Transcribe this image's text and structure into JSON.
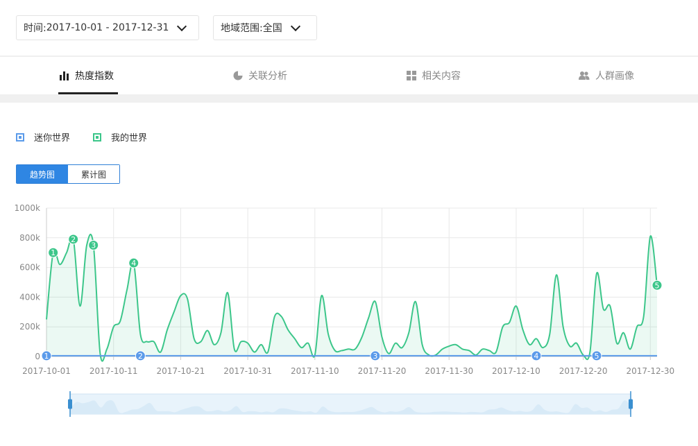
{
  "filters": {
    "time_label": "时间:",
    "time_value": "2017-10-01 - 2017-12-31",
    "region_label": "地域范围:",
    "region_value": "全国"
  },
  "tabs": [
    {
      "label": "热度指数",
      "icon": "bar-chart-icon",
      "active": true
    },
    {
      "label": "关联分析",
      "icon": "pie-chart-icon",
      "active": false
    },
    {
      "label": "相关内容",
      "icon": "grid-icon",
      "active": false
    },
    {
      "label": "人群画像",
      "icon": "users-icon",
      "active": false
    }
  ],
  "view_toggle": {
    "trend": "趋势图",
    "cumulative": "累计图",
    "selected": "趋势图"
  },
  "colors": {
    "accent": "#2f86e3",
    "series_blue": "#5b9bea",
    "series_green": "#3cc68a"
  },
  "chart_data": {
    "type": "area",
    "x_start": "2017-10-01",
    "x_ticks": [
      "2017-10-01",
      "2017-10-11",
      "2017-10-21",
      "2017-10-31",
      "2017-11-10",
      "2017-11-20",
      "2017-11-30",
      "2017-12-10",
      "2017-12-20",
      "2017-12-30"
    ],
    "y_ticks": [
      "0",
      "200k",
      "400k",
      "600k",
      "800k",
      "1000k"
    ],
    "ylim": [
      0,
      1000000
    ],
    "grid": true,
    "legend_position": "top-left",
    "series": [
      {
        "name": "迷你世界",
        "color": "#5b9bea",
        "values": [
          5000,
          5000,
          5000,
          5000,
          5000,
          5000,
          5000,
          5000,
          5000,
          5000,
          5000,
          5000,
          5000,
          5000,
          5000,
          5000,
          5000,
          5000,
          5000,
          5000,
          5000,
          5000,
          5000,
          5000,
          5000,
          5000,
          5000,
          5000,
          5000,
          5000,
          5000,
          5000,
          5000,
          5000,
          5000,
          5000,
          5000,
          5000,
          5000,
          5000,
          5000,
          5000,
          5000,
          5000,
          5000,
          5000,
          5000,
          5000,
          5000,
          5000,
          5000,
          5000,
          5000,
          5000,
          5000,
          5000,
          5000,
          5000,
          5000,
          5000,
          5000,
          5000,
          5000,
          5000,
          5000,
          5000,
          5000,
          5000,
          5000,
          5000,
          5000,
          5000,
          5000,
          5000,
          5000,
          5000,
          5000,
          5000,
          5000,
          5000,
          5000,
          5000,
          5000,
          5000,
          5000,
          5000,
          5000,
          5000,
          5000,
          5000,
          5000,
          5000
        ],
        "markers": [
          {
            "label": "1",
            "date": "2017-10-01"
          },
          {
            "label": "2",
            "date": "2017-10-15"
          },
          {
            "label": "3",
            "date": "2017-11-19"
          },
          {
            "label": "4",
            "date": "2017-12-13"
          },
          {
            "label": "5",
            "date": "2017-12-22"
          }
        ]
      },
      {
        "name": "我的世界",
        "color": "#3cc68a",
        "values": [
          250000,
          700000,
          620000,
          700000,
          790000,
          340000,
          750000,
          750000,
          20000,
          50000,
          200000,
          240000,
          450000,
          630000,
          150000,
          100000,
          100000,
          30000,
          180000,
          300000,
          410000,
          390000,
          120000,
          100000,
          175000,
          80000,
          160000,
          430000,
          50000,
          100000,
          90000,
          30000,
          80000,
          30000,
          270000,
          270000,
          180000,
          120000,
          60000,
          90000,
          10000,
          410000,
          150000,
          40000,
          40000,
          50000,
          50000,
          130000,
          260000,
          370000,
          130000,
          20000,
          90000,
          60000,
          160000,
          370000,
          80000,
          10000,
          10000,
          50000,
          70000,
          80000,
          50000,
          40000,
          10000,
          50000,
          40000,
          30000,
          200000,
          230000,
          340000,
          180000,
          80000,
          120000,
          60000,
          150000,
          550000,
          200000,
          70000,
          90000,
          10000,
          30000,
          560000,
          320000,
          340000,
          90000,
          160000,
          50000,
          200000,
          270000,
          810000,
          480000
        ],
        "markers": [
          {
            "label": "1",
            "date": "2017-10-02"
          },
          {
            "label": "2",
            "date": "2017-10-05"
          },
          {
            "label": "3",
            "date": "2017-10-08"
          },
          {
            "label": "4",
            "date": "2017-10-14"
          },
          {
            "label": "5",
            "date": "2017-12-31"
          }
        ]
      }
    ]
  }
}
